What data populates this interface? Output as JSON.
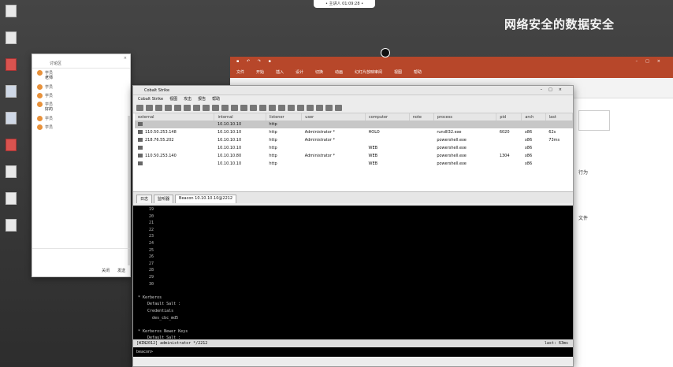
{
  "topbar": {
    "pill_text": "• 主讲人 01:09:28 •"
  },
  "watermark": "网络安全的数据安全",
  "desktop_icons": [
    {
      "label": "",
      "glyph": "doc"
    },
    {
      "label": "",
      "glyph": "doc"
    },
    {
      "label": "",
      "glyph": "red"
    },
    {
      "label": "",
      "glyph": "app"
    },
    {
      "label": "",
      "glyph": "app"
    },
    {
      "label": "",
      "glyph": "red"
    },
    {
      "label": "",
      "glyph": "doc"
    },
    {
      "label": "",
      "glyph": "doc"
    },
    {
      "label": "",
      "glyph": "doc"
    }
  ],
  "chat": {
    "tab_left": "讨论区",
    "tab_right": "",
    "messages": [
      {
        "who": "学员",
        "text": "老师"
      },
      {
        "who": "学员",
        "text": ""
      },
      {
        "who": "学员",
        "text": ""
      },
      {
        "who": "学员",
        "text": "好的"
      },
      {
        "who": "学员",
        "text": ""
      },
      {
        "who": "学员",
        "text": ""
      }
    ],
    "close_label": "关闭",
    "send_label": "发送"
  },
  "ppt": {
    "quick_access": "▪ ↶ ↷ ▪",
    "title": "",
    "user": "",
    "menu": [
      "文件",
      "开始",
      "插入",
      "设计",
      "切换",
      "动画",
      "幻灯片放映",
      "审阅",
      "视图",
      "帮助"
    ],
    "body_lines": [
      "行为",
      "文件"
    ],
    "thumb_text": ""
  },
  "cobalt": {
    "title": "Cobalt Strike",
    "menu": [
      "Cobalt Strike",
      "视图",
      "攻击",
      "报告",
      "帮助"
    ],
    "columns": [
      "external",
      "internal",
      "listener",
      "user",
      "computer",
      "note",
      "process",
      "pid",
      "arch",
      "last"
    ],
    "rows": [
      {
        "external": "",
        "internal": "10.10.10.10",
        "listener": "http",
        "user": "",
        "computer": "",
        "note": "",
        "process": "",
        "pid": "",
        "arch": "",
        "last": "",
        "selected": true
      },
      {
        "external": "110.50.253.148",
        "internal": "10.10.10.10",
        "listener": "http",
        "user": "Administrator *",
        "computer": "HOLO",
        "note": "",
        "process": "rundll32.exe",
        "pid": "6020",
        "arch": "x86",
        "last": "62s"
      },
      {
        "external": "218.76.55.202",
        "internal": "10.10.10.10",
        "listener": "http",
        "user": "Administrator *",
        "computer": "",
        "note": "",
        "process": "powershell.exe",
        "pid": "",
        "arch": "x86",
        "last": "73ms"
      },
      {
        "external": "",
        "internal": "10.10.10.10",
        "listener": "http",
        "user": "",
        "computer": "WEB",
        "note": "",
        "process": "powershell.exe",
        "pid": "",
        "arch": "x86",
        "last": ""
      },
      {
        "external": "110.50.253.140",
        "internal": "10.10.10.80",
        "listener": "http",
        "user": "Administrator *",
        "computer": "WEB",
        "note": "",
        "process": "powershell.exe",
        "pid": "1304",
        "arch": "x86",
        "last": ""
      },
      {
        "external": "",
        "internal": "10.10.10.10",
        "listener": "http",
        "user": "",
        "computer": "WEB",
        "note": "",
        "process": "powershell.exe",
        "pid": "",
        "arch": "x86",
        "last": ""
      }
    ],
    "tabs": [
      "日志",
      "监听器",
      "Beacon 10.10.10.10@2212"
    ],
    "console_lines": [
      {
        "n": "19",
        "t": ""
      },
      {
        "n": "20",
        "t": ""
      },
      {
        "n": "21",
        "t": ""
      },
      {
        "n": "22",
        "t": ""
      },
      {
        "n": "23",
        "t": ""
      },
      {
        "n": "24",
        "t": ""
      },
      {
        "n": "25",
        "t": ""
      },
      {
        "n": "26",
        "t": ""
      },
      {
        "n": "27",
        "t": ""
      },
      {
        "n": "28",
        "t": ""
      },
      {
        "n": "29",
        "t": ""
      },
      {
        "n": "30",
        "t": ""
      }
    ],
    "console_tail": [
      "",
      "* Kerberos",
      "    Default Salt :",
      "    Credentials",
      "      des_cbc_md5",
      "",
      "* Kerberos Newer Keys",
      "    Default Salt :"
    ],
    "status_left": "[WIN2012] administrator */2212",
    "status_right": "last: 63ms",
    "prompt": "beacon>"
  }
}
